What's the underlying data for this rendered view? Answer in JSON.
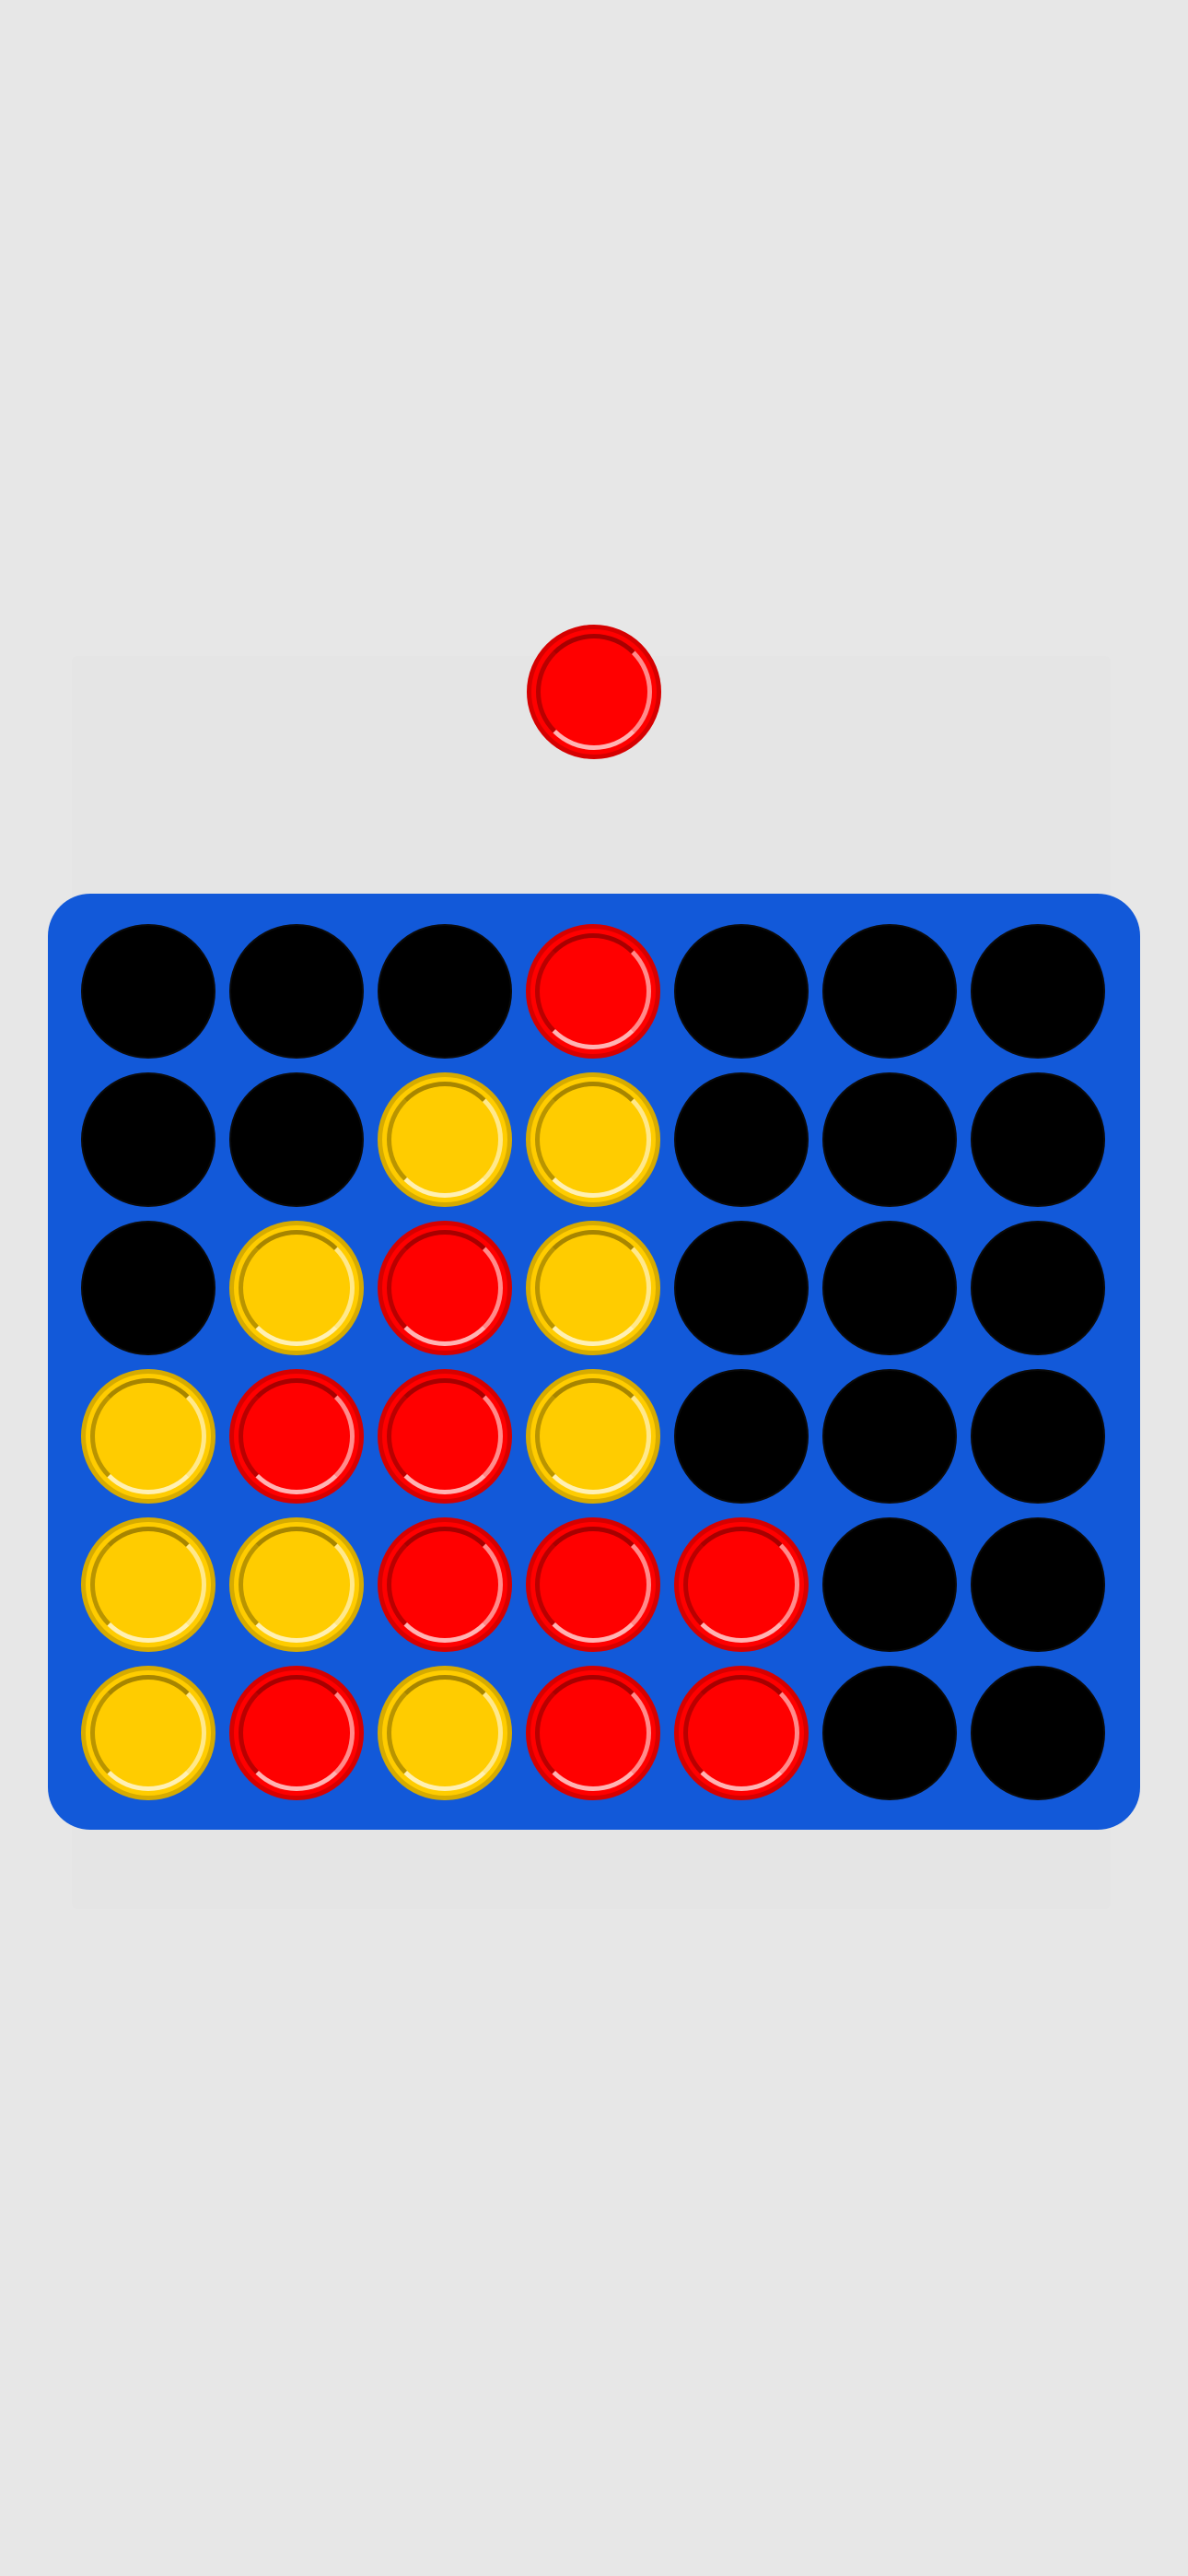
{
  "colors": {
    "background": "#e7e7e7",
    "board": "#1259d9",
    "empty": "#000000",
    "red": "#ff0000",
    "yellow": "#ffcc00"
  },
  "current_piece": "red",
  "board": {
    "rows": 6,
    "columns": 7,
    "cells": [
      [
        "empty",
        "empty",
        "empty",
        "red",
        "empty",
        "empty",
        "empty"
      ],
      [
        "empty",
        "empty",
        "yellow",
        "yellow",
        "empty",
        "empty",
        "empty"
      ],
      [
        "empty",
        "yellow",
        "red",
        "yellow",
        "empty",
        "empty",
        "empty"
      ],
      [
        "yellow",
        "red",
        "red",
        "yellow",
        "empty",
        "empty",
        "empty"
      ],
      [
        "yellow",
        "yellow",
        "red",
        "red",
        "red",
        "empty",
        "empty"
      ],
      [
        "yellow",
        "red",
        "yellow",
        "red",
        "red",
        "empty",
        "empty"
      ]
    ]
  }
}
